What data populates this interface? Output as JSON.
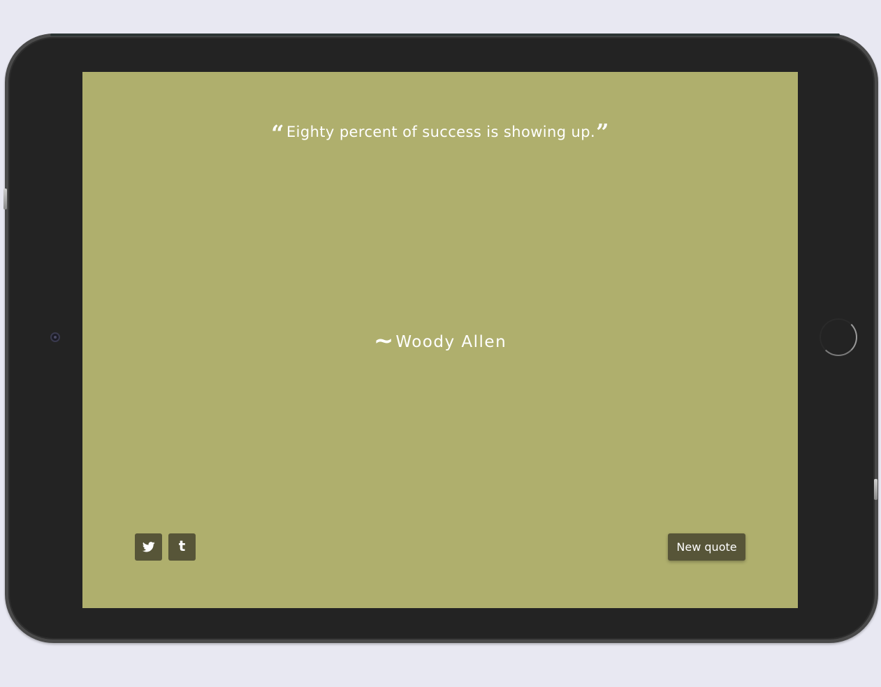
{
  "quote": {
    "open_mark": "“",
    "text": "Eighty percent of success is showing up.",
    "close_mark": "”"
  },
  "author": {
    "prefix": "~",
    "name": "Woody Allen"
  },
  "actions": {
    "twitter_icon": "twitter-bird",
    "tumblr_icon": "tumblr-t",
    "tumblr_glyph": "t",
    "new_quote_label": "New quote"
  },
  "colors": {
    "page_background": "#e8e8f2",
    "tablet_body": "#232323",
    "screen_background": "#afaf6d",
    "button_background": "#575538",
    "text": "#ffffff"
  }
}
